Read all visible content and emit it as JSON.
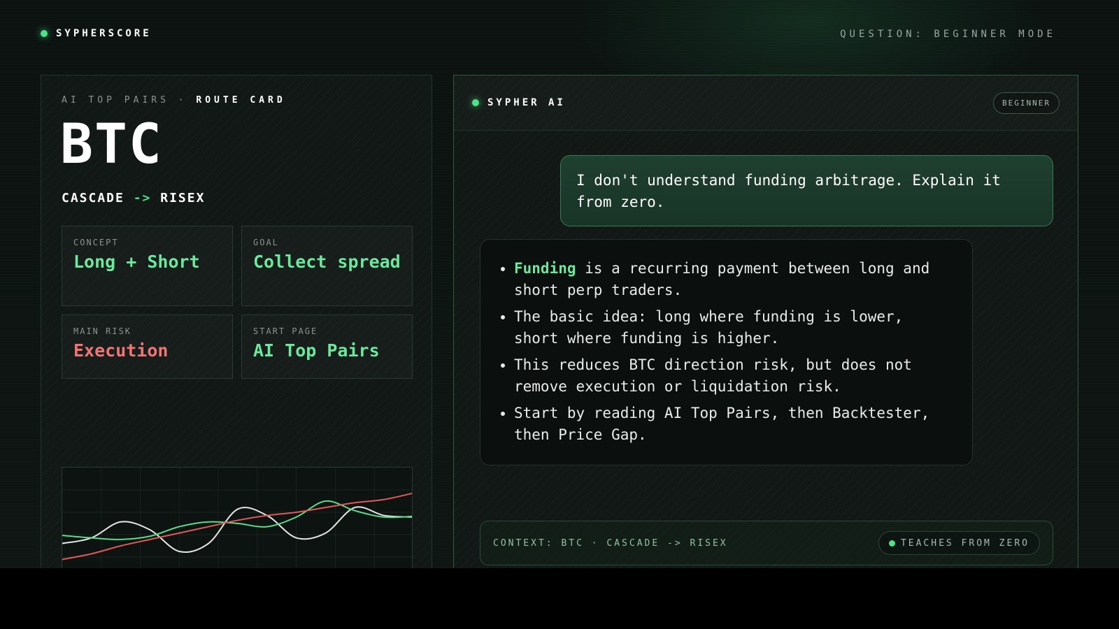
{
  "header": {
    "brand": "SYPHERSCORE",
    "mode": "QUESTION: BEGINNER MODE"
  },
  "route_card": {
    "eyebrow_prefix": "AI TOP PAIRS ·",
    "eyebrow_strong": "ROUTE CARD",
    "ticker": "BTC",
    "route_from": "CASCADE",
    "route_arrow": "->",
    "route_to": "RISEX",
    "tiles": [
      {
        "label": "CONCEPT",
        "value": "Long + Short"
      },
      {
        "label": "GOAL",
        "value": "Collect spread"
      },
      {
        "label": "MAIN RISK",
        "value": "Execution"
      },
      {
        "label": "START PAGE",
        "value": "AI Top Pairs"
      }
    ]
  },
  "chat": {
    "assistant_name": "SYPHER AI",
    "level_badge": "BEGINNER",
    "user_message": "I don't understand funding arbitrage. Explain it from zero.",
    "answer": {
      "bullet1_highlight": "Funding",
      "bullet1_rest": " is a recurring payment between long and short perp traders.",
      "bullet2": "The basic idea: long where funding is lower, short where funding is higher.",
      "bullet3": "This reduces BTC direction risk, but does not remove execution or liquidation risk.",
      "bullet4": "Start by reading AI Top Pairs, then Backtester, then Price Gap."
    },
    "context": "CONTEXT: BTC · CASCADE -> RISEX",
    "context_pill": "TEACHES FROM ZERO"
  },
  "colors": {
    "accent_green": "#4ee38a",
    "value_green": "#6ce79c",
    "risk_red": "#f07575",
    "line_white": "#e6e6e6",
    "line_green": "#5bdc8c",
    "line_red": "#e05a5a"
  },
  "chart_data": {
    "type": "line",
    "x": [
      0,
      1,
      2,
      3,
      4,
      5,
      6,
      7,
      8,
      9,
      10,
      11,
      12
    ],
    "series": [
      {
        "color": "#e6e6e6",
        "values": [
          0.45,
          0.52,
          0.72,
          0.62,
          0.35,
          0.45,
          0.88,
          0.8,
          0.52,
          0.58,
          0.9,
          0.8,
          0.78
        ]
      },
      {
        "color": "#5bdc8c",
        "values": [
          0.55,
          0.52,
          0.5,
          0.54,
          0.66,
          0.72,
          0.7,
          0.66,
          0.78,
          0.98,
          0.86,
          0.78,
          0.79
        ]
      },
      {
        "color": "#e05a5a",
        "values": [
          0.25,
          0.32,
          0.42,
          0.5,
          0.58,
          0.66,
          0.74,
          0.8,
          0.84,
          0.9,
          0.96,
          1.0,
          1.08
        ]
      }
    ],
    "ylim": [
      0,
      1.4
    ],
    "grid": true
  }
}
